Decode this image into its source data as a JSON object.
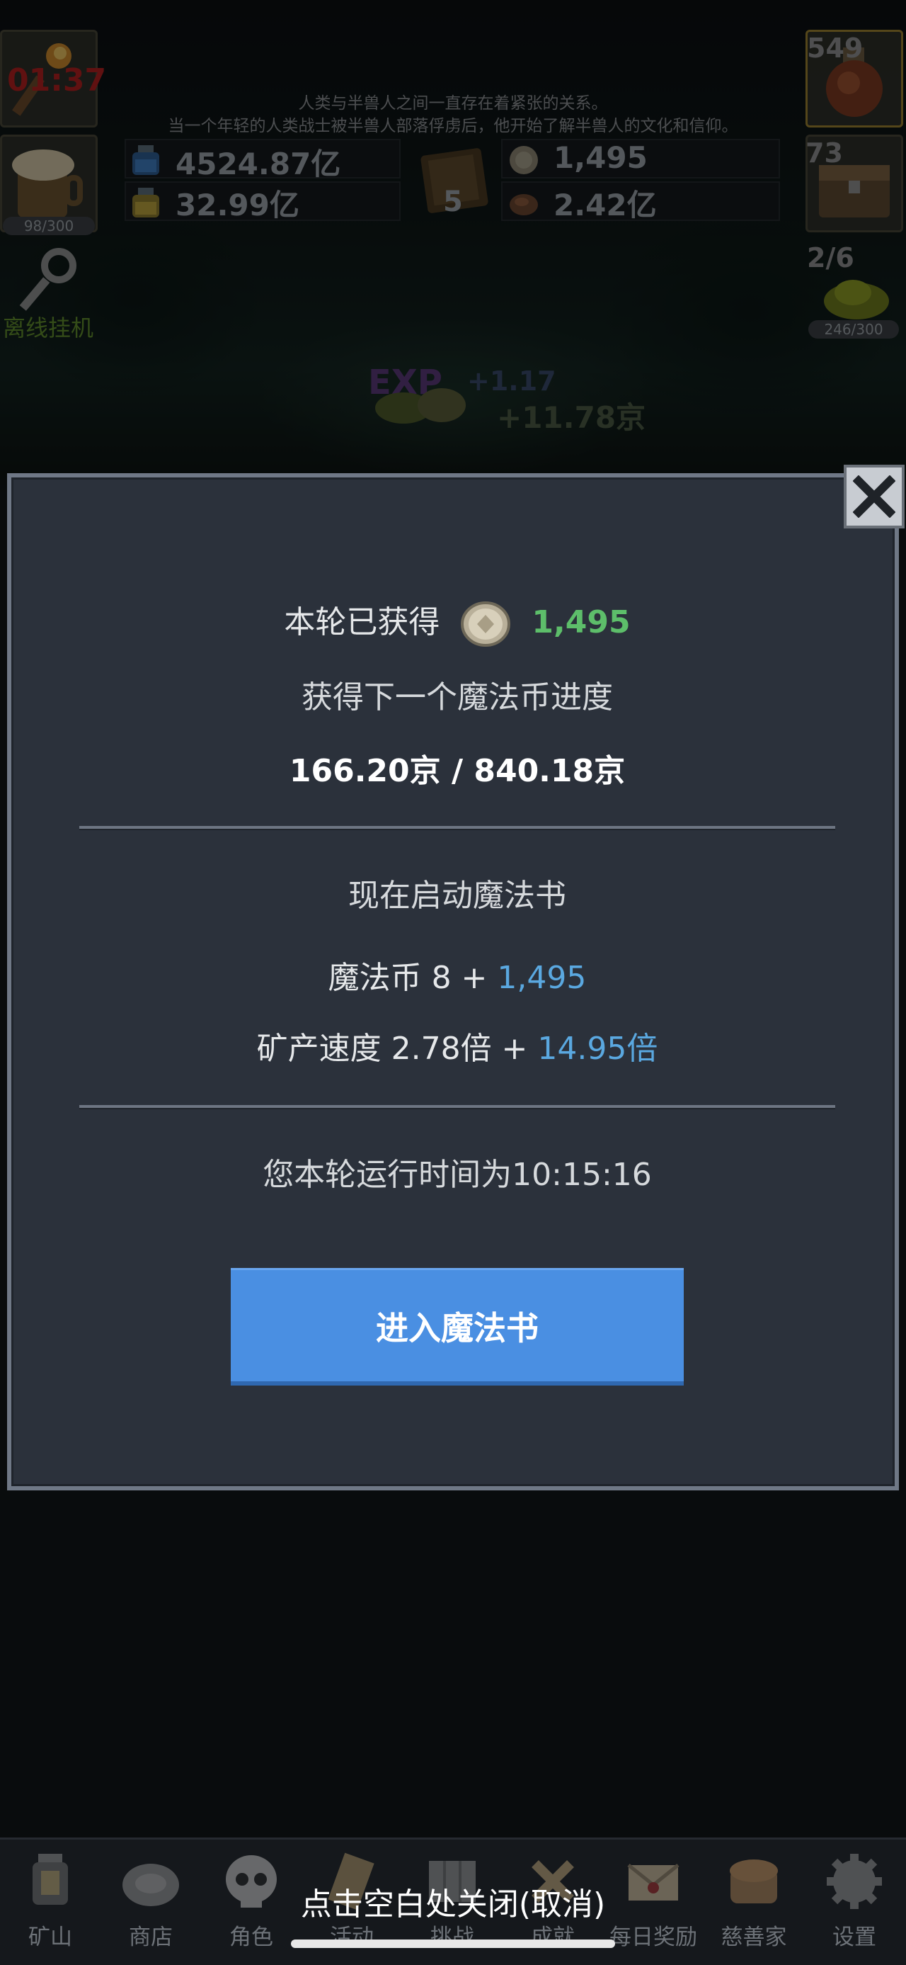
{
  "top_bar": {
    "timer": "01:37",
    "story_line_1": "人类与半兽人之间一直存在着紧张的关系。",
    "story_line_2": "当一个年轻的人类战士被半兽人部落俘虏后，他开始了解半兽人的文化和信仰。",
    "resource_blue_potion": "4524.87亿",
    "resource_yellow_potion": "32.99亿",
    "book_count": "5",
    "coins": "1,495",
    "ore": "2.42亿",
    "potion_badge": "549",
    "chest_badge": "73",
    "slime_progress": "2/6",
    "slime_bar": "246/300",
    "beer_bar": "98/300",
    "offline_label": "离线挂机",
    "exp_gain": "+1.17",
    "coin_gain": "+11.78京"
  },
  "modal": {
    "earned_label": "本轮已获得",
    "earned_value": "1,495",
    "next_progress_label": "获得下一个魔法币进度",
    "progress_value": "166.20京 / 840.18京",
    "start_label": "现在启动魔法书",
    "magic_coin_label": "魔法币 8 + ",
    "magic_coin_bonus": "1,495",
    "mine_speed_label": "矿产速度 2.78倍 + ",
    "mine_speed_bonus": "14.95倍",
    "runtime": "您本轮运行时间为10:15:16",
    "enter_button": "进入魔法书"
  },
  "nav": {
    "items": [
      {
        "label": "矿山",
        "icon": "lantern-icon"
      },
      {
        "label": "商店",
        "icon": "shell-icon"
      },
      {
        "label": "角色",
        "icon": "skull-icon"
      },
      {
        "label": "活动",
        "icon": "scroll-icon"
      },
      {
        "label": "挑战",
        "icon": "map-icon"
      },
      {
        "label": "成就",
        "icon": "bone-icon"
      },
      {
        "label": "每日奖励",
        "icon": "letter-icon"
      },
      {
        "label": "慈善家",
        "icon": "bread-icon"
      },
      {
        "label": "设置",
        "icon": "gear-icon"
      }
    ],
    "dismiss_hint": "点击空白处关闭(取消)"
  },
  "colors": {
    "accent_blue": "#4a8fe2",
    "green_value": "#5dbe6a",
    "bonus_blue": "#5aa8e0",
    "modal_bg": "#2b313b"
  }
}
